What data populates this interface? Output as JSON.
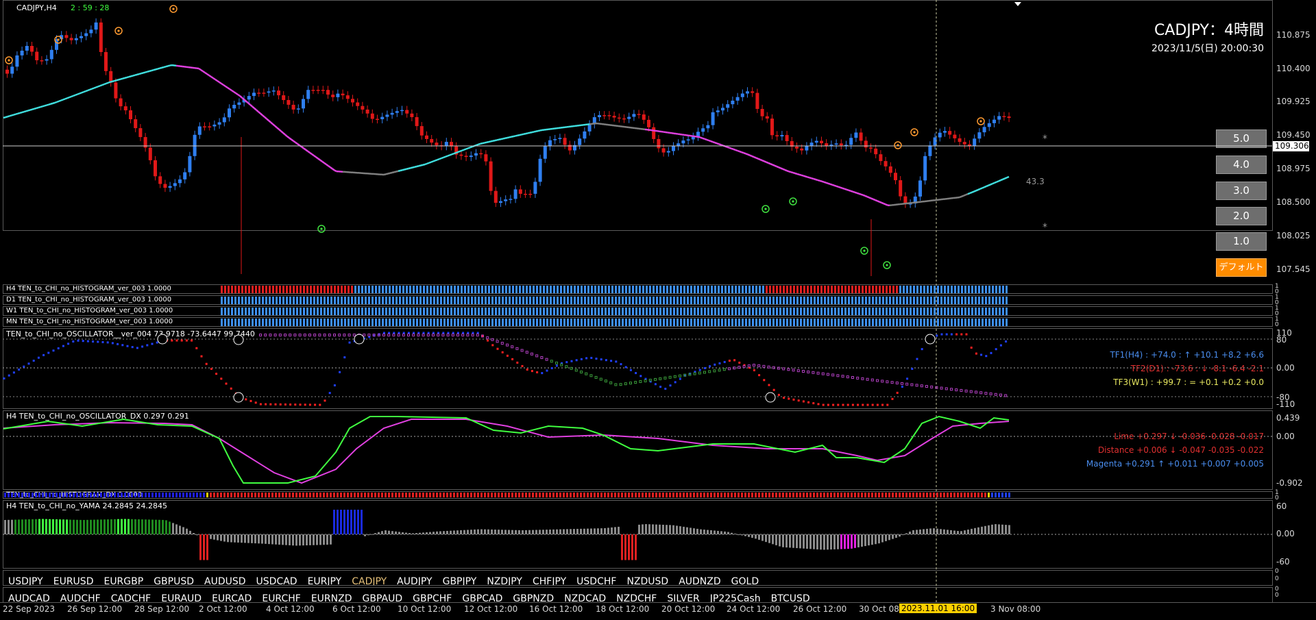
{
  "main": {
    "symbol": "CADJPY,H4",
    "countdown": "2 : 59 : 28",
    "title": "CADJPY：4時間",
    "datetime": "2023/11/5(日) 20:00:30",
    "price_axis": [
      "110.875",
      "110.400",
      "109.925",
      "109.450",
      "108.975",
      "108.500",
      "108.025",
      "107.545"
    ],
    "current_price": "109.306",
    "annotation": "43.3",
    "asterisk": "*",
    "buttons": [
      "5.0",
      "4.0",
      "3.0",
      "2.0",
      "1.0",
      "デフォルト"
    ]
  },
  "histograms": [
    "H4 TEN_to_CHI_no_HISTOGRAM_ver_003 1.0000",
    "D1 TEN_to_CHI_no_HISTOGRAM_ver_003 1.0000",
    "W1 TEN_to_CHI_no_HISTOGRAM_ver_003 1.0000",
    "MN TEN_to_CHI_no_HISTOGRAM_ver_003 1.0000"
  ],
  "hist_axis": [
    "1",
    "0",
    "1",
    "0",
    "1",
    "0",
    "1",
    "0"
  ],
  "oscillator": {
    "title": "TEN_to_CHI_no_OSCILLATOR__ver_004 73.9718 -73.6447 99.7440",
    "axis": [
      "110",
      "80",
      "0.00",
      "-80",
      "-110"
    ],
    "tf1": "TF1(H4) : +74.0 : ↑ +10.1 +8.2 +6.6",
    "tf2": "TF2(D1) : -73.6 : ↓ -8.1 -6.4 -2.1",
    "tf3": "TF3(W1) : +99.7 : = +0.1 +0.2 +0.0",
    "markers": [
      "④",
      "⑤",
      "①",
      "①",
      "①",
      "①"
    ]
  },
  "dx": {
    "title": "H4 TEN_to_CHI_no_OSCILLATOR_DX 0.297 0.291",
    "axis": [
      "0.439",
      "0.00",
      "-0.902"
    ],
    "lime": "Lime +0.297 ↓ -0.036 -0.028 -0.017",
    "distance": "Distance +0.006 ↓ -0.047 -0.035 -0.022",
    "magenta": "Magenta +0.291 ↑ +0.011 +0.007 +0.005"
  },
  "hist_dx": {
    "title": "TEN_to_CHI_no_HISTOGRAM_DX 0.0000",
    "axis": [
      "1",
      "0"
    ]
  },
  "yama": {
    "title": "H4 TEN_to_CHI_no_YAMA 24.2845 24.2845",
    "axis": [
      "60",
      "0.00",
      "-60"
    ]
  },
  "symbols_row1": [
    "USDJPY",
    "EURUSD",
    "EURGBP",
    "GBPUSD",
    "AUDUSD",
    "USDCAD",
    "EURJPY",
    "CADJPY",
    "AUDJPY",
    "GBPJPY",
    "NZDJPY",
    "CHFJPY",
    "USDCHF",
    "NZDUSD",
    "AUDNZD",
    "GOLD"
  ],
  "symbols_row2": [
    "AUDCAD",
    "AUDCHF",
    "CADCHF",
    "EURAUD",
    "EURCAD",
    "EURCHF",
    "EURNZD",
    "GBPAUD",
    "GBPCHF",
    "GBPCAD",
    "GBPNZD",
    "NZDCAD",
    "NZDCHF",
    "SILVER",
    "JP225Cash",
    "BTCUSD"
  ],
  "active_symbol": "CADJPY",
  "row_axis": [
    "0",
    "0",
    "0",
    "0"
  ],
  "time_axis": [
    "22 Sep 2023",
    "26 Sep 12:00",
    "28 Sep 12:00",
    "2 Oct 12:00",
    "4 Oct 12:00",
    "6 Oct 12:00",
    "10 Oct 12:00",
    "12 Oct 12:00",
    "16 Oct 12:00",
    "18 Oct 12:00",
    "20 Oct 12:00",
    "24 Oct 12:00",
    "26 Oct 12:00",
    "30 Oct 08:00",
    "3 Nov 08:00"
  ],
  "cursor_time": "2023.11.01 16:00",
  "colors": {
    "up": "#2f7ff0",
    "down": "#e01818",
    "ma_up": "#40e0e0",
    "ma_down": "#e040e0",
    "ma_flat": "#808080",
    "lime": "#40ff40",
    "button": "#6e6e6e",
    "default_button": "#ff8c00"
  }
}
